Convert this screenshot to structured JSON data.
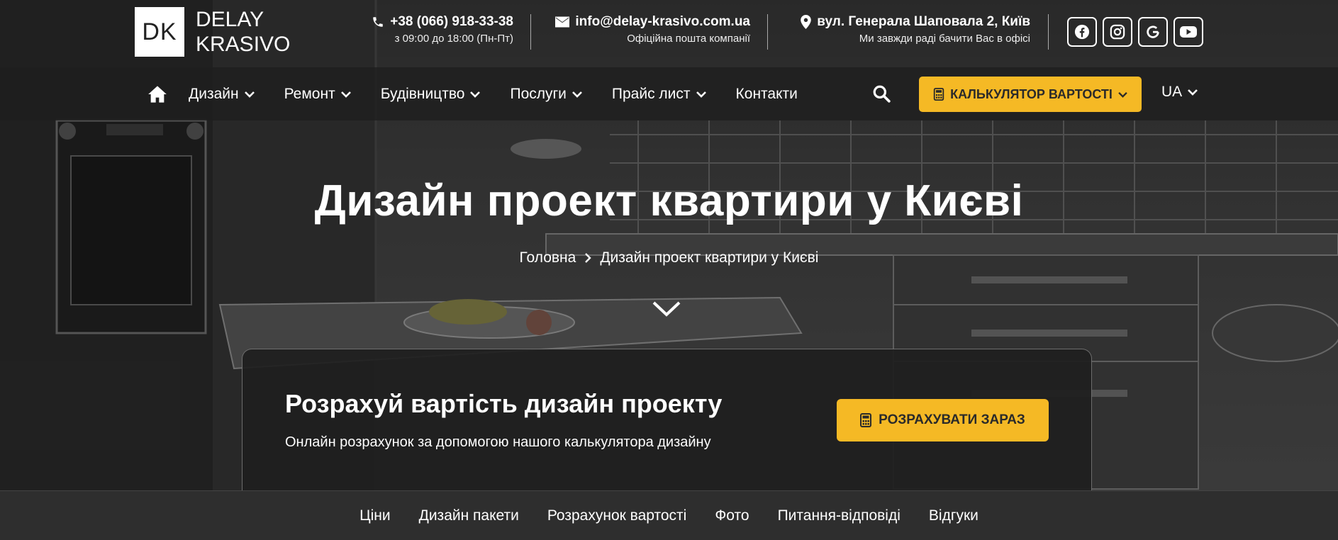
{
  "brand": {
    "logo_mark": "DK",
    "name_line1": "DELAY",
    "name_line2": "KRASIVO"
  },
  "contacts": {
    "phone": {
      "icon": "phone-icon",
      "value": "+38 (066) 918-33-38",
      "note": "з 09:00 до 18:00 (Пн-Пт)"
    },
    "email": {
      "icon": "envelope-icon",
      "value": "info@delay-krasivo.com.ua",
      "note": "Офіційна пошта компанії"
    },
    "address": {
      "icon": "map-pin-icon",
      "value": "вул. Генерала Шаповала 2, Київ",
      "note": "Ми завжди раді бачити Вас в офісі"
    }
  },
  "socials": [
    {
      "name": "facebook-icon"
    },
    {
      "name": "instagram-icon"
    },
    {
      "name": "google-icon"
    },
    {
      "name": "youtube-icon"
    }
  ],
  "nav": {
    "home_icon": "home-icon",
    "items": [
      {
        "label": "Дизайн",
        "has_dropdown": true
      },
      {
        "label": "Ремонт",
        "has_dropdown": true
      },
      {
        "label": "Будівництво",
        "has_dropdown": true
      },
      {
        "label": "Послуги",
        "has_dropdown": true
      },
      {
        "label": "Прайс лист",
        "has_dropdown": true
      },
      {
        "label": "Контакти",
        "has_dropdown": false
      }
    ],
    "search_icon": "search-icon",
    "calc_button": "КАЛЬКУЛЯТОР ВАРТОСТІ",
    "language": "UA"
  },
  "hero": {
    "title": "Дизайн проект квартири у Києві",
    "breadcrumb": {
      "home": "Головна",
      "current": "Дизайн проект квартири у Києві"
    }
  },
  "card": {
    "title": "Розрахуй вартість дизайн проекту",
    "subtitle": "Онлайн розрахунок за допомогою нашого калькулятора дизайну",
    "button": "РОЗРАХУВАТИ ЗАРАЗ"
  },
  "tabs": [
    {
      "label": "Ціни"
    },
    {
      "label": "Дизайн пакети"
    },
    {
      "label": "Розрахунок вартості"
    },
    {
      "label": "Фото"
    },
    {
      "label": "Питання-відповіді"
    },
    {
      "label": "Відгуки"
    }
  ],
  "colors": {
    "accent": "#f5b925",
    "nav_bg": "#1e1e1e",
    "tabbar_bg": "#2e2e2e"
  }
}
